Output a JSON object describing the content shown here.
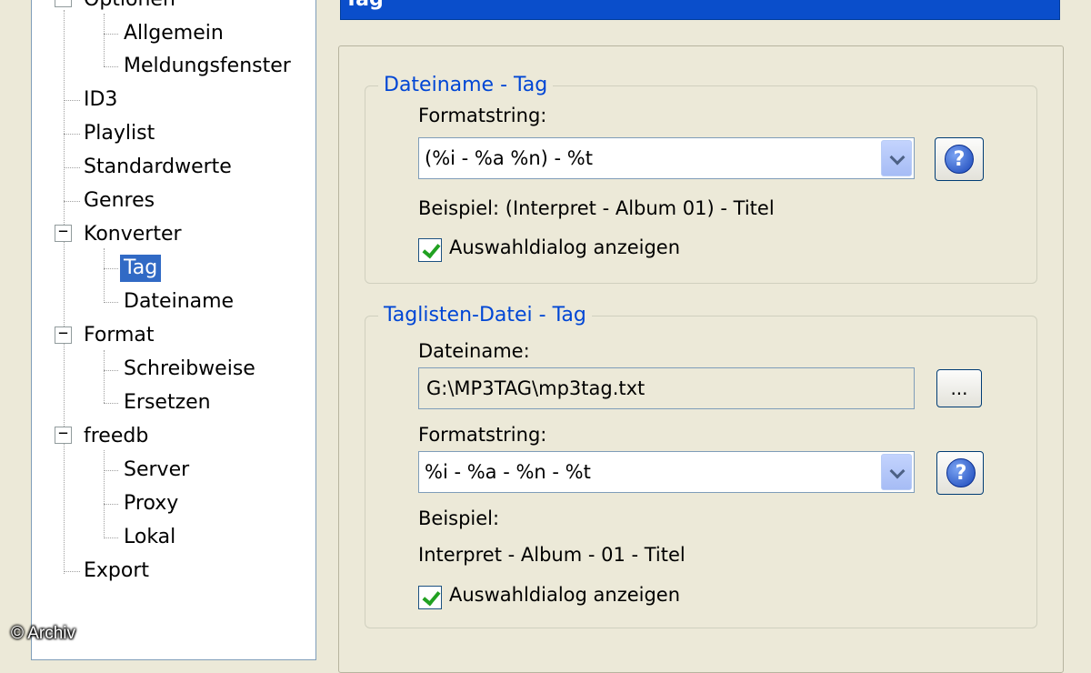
{
  "header": {
    "title": "Tag"
  },
  "tree": [
    {
      "label": "Optionen"
    },
    {
      "label": "Allgemein"
    },
    {
      "label": "Meldungsfenster"
    },
    {
      "label": "ID3"
    },
    {
      "label": "Playlist"
    },
    {
      "label": "Standardwerte"
    },
    {
      "label": "Genres"
    },
    {
      "label": "Konverter"
    },
    {
      "label": "Tag"
    },
    {
      "label": "Dateiname"
    },
    {
      "label": "Format"
    },
    {
      "label": "Schreibweise"
    },
    {
      "label": "Ersetzen"
    },
    {
      "label": "freedb"
    },
    {
      "label": "Server"
    },
    {
      "label": "Proxy"
    },
    {
      "label": "Lokal"
    },
    {
      "label": "Export"
    }
  ],
  "selected_tree_item": "Tag",
  "watermark": "© Archiv",
  "group_filename": {
    "title": "Dateiname  -  Tag",
    "format_label": "Formatstring:",
    "format_value": "(%i - %a  %n) - %t",
    "example": "Beispiel: (Interpret - Album  01) - Titel",
    "checkbox_label": "Auswahldialog anzeigen",
    "checkbox_checked": true
  },
  "group_taglist": {
    "title": "Taglisten-Datei - Tag",
    "filename_label": "Dateiname:",
    "filename_value": "G:\\MP3TAG\\mp3tag.txt",
    "browse_label": "...",
    "format_label": "Formatstring:",
    "format_value": "%i - %a - %n - %t",
    "example_label": "Beispiel:",
    "example_value": "Interpret - Album - 01 - Titel",
    "checkbox_label": "Auswahldialog anzeigen",
    "checkbox_checked": true
  },
  "icons": {
    "help": "help-icon",
    "dropdown": "chevron-down-icon",
    "expander": "minus-expander-icon"
  },
  "colors": {
    "selection": "#316ac5",
    "header": "#0a4ecb",
    "group_title": "#0046d5",
    "background": "#ece9d8"
  }
}
